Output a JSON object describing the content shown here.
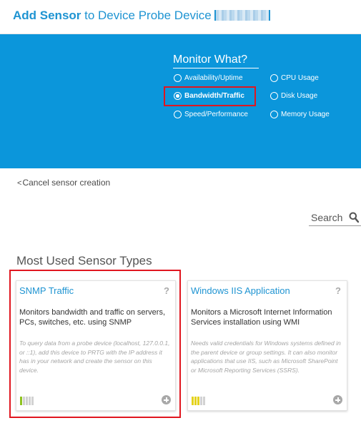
{
  "header": {
    "title_strong": "Add Sensor",
    "title_rest": " to Device Probe Device"
  },
  "monitor": {
    "title": "Monitor What?",
    "options": [
      {
        "label": "Availability/Uptime",
        "selected": false
      },
      {
        "label": "Bandwidth/Traffic",
        "selected": true
      },
      {
        "label": "Speed/Performance",
        "selected": false
      },
      {
        "label": "CPU Usage",
        "selected": false
      },
      {
        "label": "Disk Usage",
        "selected": false
      },
      {
        "label": "Memory Usage",
        "selected": false
      }
    ]
  },
  "cancel": {
    "chevron": "<",
    "label": "Cancel sensor creation"
  },
  "search": {
    "placeholder": "Search",
    "icon": "search-icon"
  },
  "section": {
    "title": "Most Used Sensor Types"
  },
  "cards": [
    {
      "name": "SNMP Traffic",
      "help": "?",
      "description": "Monitors bandwidth and traffic on servers, PCs, switches, etc. using SNMP",
      "note": "To query data from a probe device (localhost, 127.0.0.1, or ::1), add this device to PRTG with the IP address it has in your network and create the sensor on this device.",
      "performance_bars_active": 1,
      "performance_color": "#8fc31f"
    },
    {
      "name": "Windows IIS Application",
      "help": "?",
      "description": "Monitors a Microsoft Internet Information Services installation using WMI",
      "note": "Needs valid credentials for Windows systems defined in the parent device or group settings. It can also monitor applications that use IIS, such as Microsoft SharePoint or Microsoft Reporting Services (SSRS).",
      "performance_bars_active": 3,
      "performance_color": "#e4d21c"
    }
  ],
  "colors": {
    "brand": "#1f94d2",
    "band": "#0b96db",
    "highlight": "#e0161f"
  }
}
